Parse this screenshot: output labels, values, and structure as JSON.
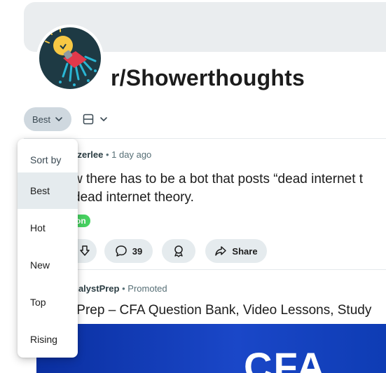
{
  "subreddit": {
    "name": "r/Showerthoughts"
  },
  "toolbar": {
    "sort_label": "Best"
  },
  "posts": [
    {
      "author": "zzerlee",
      "time": "1 day ago",
      "title_line1": "w there has to be a bot that posts “dead internet t",
      "title_line2": "dead internet theory.",
      "flair": "on",
      "comments": "39",
      "share_label": "Share"
    },
    {
      "author": "nalystPrep",
      "promoted_label": "Promoted",
      "title": "tPrep – CFA Question Bank, Video Lessons, Study",
      "image_text": "CFA"
    }
  ],
  "sort_menu": {
    "header": "Sort by",
    "items": [
      "Best",
      "Hot",
      "New",
      "Top",
      "Rising"
    ],
    "selected": "Best"
  },
  "colors": {
    "flair": "#46d160",
    "ad_blue": "#1a47c8"
  }
}
